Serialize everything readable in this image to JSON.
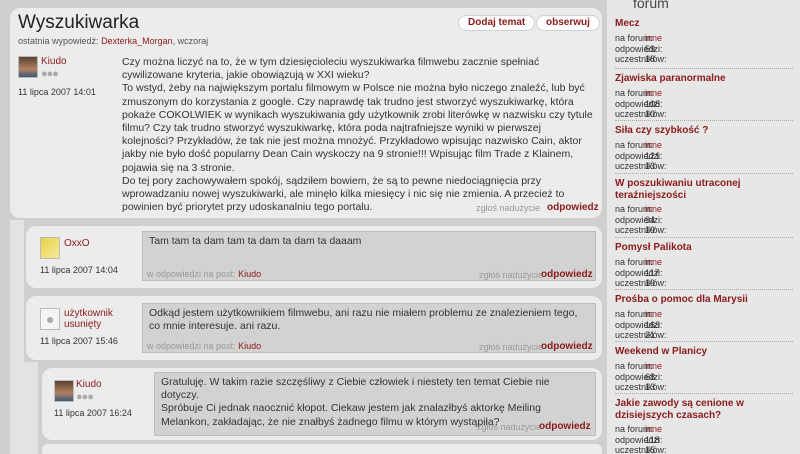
{
  "thread": {
    "title": "Wyszukiwarka",
    "last_reply_prefix": "ostatnia wypowiedź:",
    "last_reply_user": "Dexterka_Morgan",
    "last_reply_when": "wczoraj",
    "add_topic_label": "Dodaj temat",
    "watch_label": "obserwuj"
  },
  "first_post": {
    "author": "Kiudo",
    "date": "11 lipca 2007 14:01",
    "text": "Czy można liczyć na to, że w tym dziesięcioleciu wyszukiwarka filmwebu zacznie spełniać cywilizowane kryteria, jakie obowiązują w XXI wieku?\nTo wstyd, żeby na największym portalu filmowym w Polsce nie można było niczego znaleźć, lub być zmuszonym do korzystania z google. Czy naprawdę tak trudno jest stworzyć wyszukiwarkę, która pokaże COKOLWIEK w wynikach wyszukiwania gdy użytkownik zrobi literówkę w nazwisku czy tytule filmu? Czy tak trudno stworzyć wyszukiwarkę, która poda najtrafniejsze wyniki w pierwszej kolejności? Przykładów, że tak nie jest można mnożyć. Przykładowo wpisując nazwisko Cain, aktor jakby nie było dość popularny Dean Cain wyskoczy na 9 stronie!!! Wpisując film Trade z Klainem, pojawia się na 3 stronie.\nDo tej pory zachowywałem spokój, sądziłem bowiem, że są to pewne niedociągnięcia przy wprowadzaniu nowej wyszukiwarki, ale minęło kilka miesięcy i nic się nie zmienia. A przecież to powinien być priorytet przy udoskanalniu tego portalu.",
    "report_label": "zgłoś nadużycie",
    "reply_label": "odpowiedz"
  },
  "replies": [
    {
      "author": "OxxO",
      "date": "11 lipca 2007 14:04",
      "text": "Tam tam ta dam tam ta dam ta dam ta daaam",
      "in_reply_prefix": "w odpowiedzi na post:",
      "in_reply_user": "Kiudo",
      "report_label": "zgłoś nadużycie",
      "reply_label": "odpowiedz"
    },
    {
      "author": "użytkownik usunięty",
      "date": "11 lipca 2007 15:46",
      "text": "Odkąd jestem użytkownikiem filmwebu, ani razu nie miałem problemu ze znalezieniem tego, co mnie interesuje. ani razu.",
      "in_reply_prefix": "w odpowiedzi na post:",
      "in_reply_user": "Kiudo",
      "report_label": "zgłoś nadużycie",
      "reply_label": "odpowiedz"
    },
    {
      "author": "Kiudo",
      "date": "11 lipca 2007 16:24",
      "text": "Gratuluję. W takim razie szczęśliwy z Ciebie człowiek i niestety ten temat Ciebie nie dotyczy.\nSpróbuje Ci jednak naocznić kłopot. Ciekaw jestem jak znalazłbyś aktorkę Meiling Melankon, zakładając, że nie znałbyś żadnego filmu w którym wystąpiła?",
      "report_label": "zgłoś nadużycie",
      "reply_label": "odpowiedz"
    }
  ],
  "sidebar": {
    "title": "forum",
    "labels": {
      "forum": "na forum:",
      "replies": "odpowiedzi:",
      "participants": "uczestników:"
    },
    "forums": [
      {
        "name": "Mecz",
        "forum": "inne",
        "replies": "59",
        "participants": "18"
      },
      {
        "name": "Zjawiska paranormalne",
        "forum": "inne",
        "replies": "108",
        "participants": "10"
      },
      {
        "name": "Siła czy szybkość ?",
        "forum": "inne",
        "replies": "121",
        "participants": "13"
      },
      {
        "name": "W poszukiwaniu utraconej teraźniejszości",
        "forum": "inne",
        "replies": "94",
        "participants": "19"
      },
      {
        "name": "Pomysł Palikota",
        "forum": "inne",
        "replies": "117",
        "participants": "19"
      },
      {
        "name": "Prośba o pomoc dla Marysii",
        "forum": "inne",
        "replies": "163",
        "participants": "21"
      },
      {
        "name": "Weekend w Planicy",
        "forum": "inne",
        "replies": "68",
        "participants": "13"
      },
      {
        "name": "Jakie zawody są cenione w dzisiejszych czasach?",
        "forum": "inne",
        "replies": "118",
        "participants": "15"
      }
    ]
  },
  "colors": {
    "accent": "#8b1a1a",
    "card": "#ececec",
    "message": "#d2d2d2"
  }
}
